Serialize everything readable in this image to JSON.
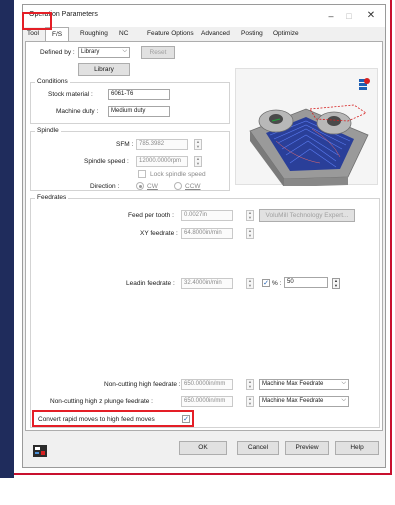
{
  "window": {
    "title": "Operation Parameters",
    "minimize": "–",
    "maximize": "□",
    "close": "✕"
  },
  "tabs": [
    {
      "label": "Tool"
    },
    {
      "label": "F/S"
    },
    {
      "label": "Roughing"
    },
    {
      "label": "NC"
    },
    {
      "label": "Feature Options"
    },
    {
      "label": "Advanced"
    },
    {
      "label": "Posting"
    },
    {
      "label": "Optimize"
    }
  ],
  "defined_by": {
    "label": "Defined by :",
    "value": "Library",
    "reset_label": "Reset",
    "library_button": "Library"
  },
  "conditions": {
    "title": "Conditions",
    "stock_material_label": "Stock material :",
    "stock_material_value": "6061-T6",
    "machine_duty_label": "Machine duty :",
    "machine_duty_value": "Medium duty"
  },
  "spindle": {
    "title": "Spindle",
    "sfm_label": "SFM :",
    "sfm_value": "785.3982",
    "speed_label": "Spindle speed :",
    "speed_value": "12000.0000rpm",
    "lock_label": "Lock spindle speed",
    "direction_label": "Direction :",
    "cw_label": "CW",
    "ccw_label": "CCW"
  },
  "feedrates": {
    "title": "Feedrates",
    "feed_per_tooth_label": "Feed per tooth :",
    "feed_per_tooth_value": "0.0027in",
    "volumill_button": "VoluMill Technology Expert...",
    "xy_feedrate_label": "XY feedrate :",
    "xy_feedrate_value": "64.8000in/min",
    "leadin_label": "Leadin feedrate :",
    "leadin_value": "32.4000in/min",
    "percent_label": "% :",
    "percent_value": "50",
    "noncut_high_label": "Non-cutting high feedrate :",
    "noncut_high_value": "650.0000in/mm",
    "noncut_high_mode": "Machine Max Feedrate",
    "noncut_z_label": "Non-cutting high z plunge feedrate :",
    "noncut_z_value": "650.0000in/mm",
    "noncut_z_mode": "Machine Max Feedrate",
    "convert_label": "Convert rapid moves to high feed moves"
  },
  "footer": {
    "ok": "OK",
    "cancel": "Cancel",
    "preview": "Preview",
    "help": "Help"
  },
  "colors": {
    "accent_red": "#e41e26",
    "navy": "#1f2c5c",
    "toolpath_blue": "#3a5bc7"
  }
}
